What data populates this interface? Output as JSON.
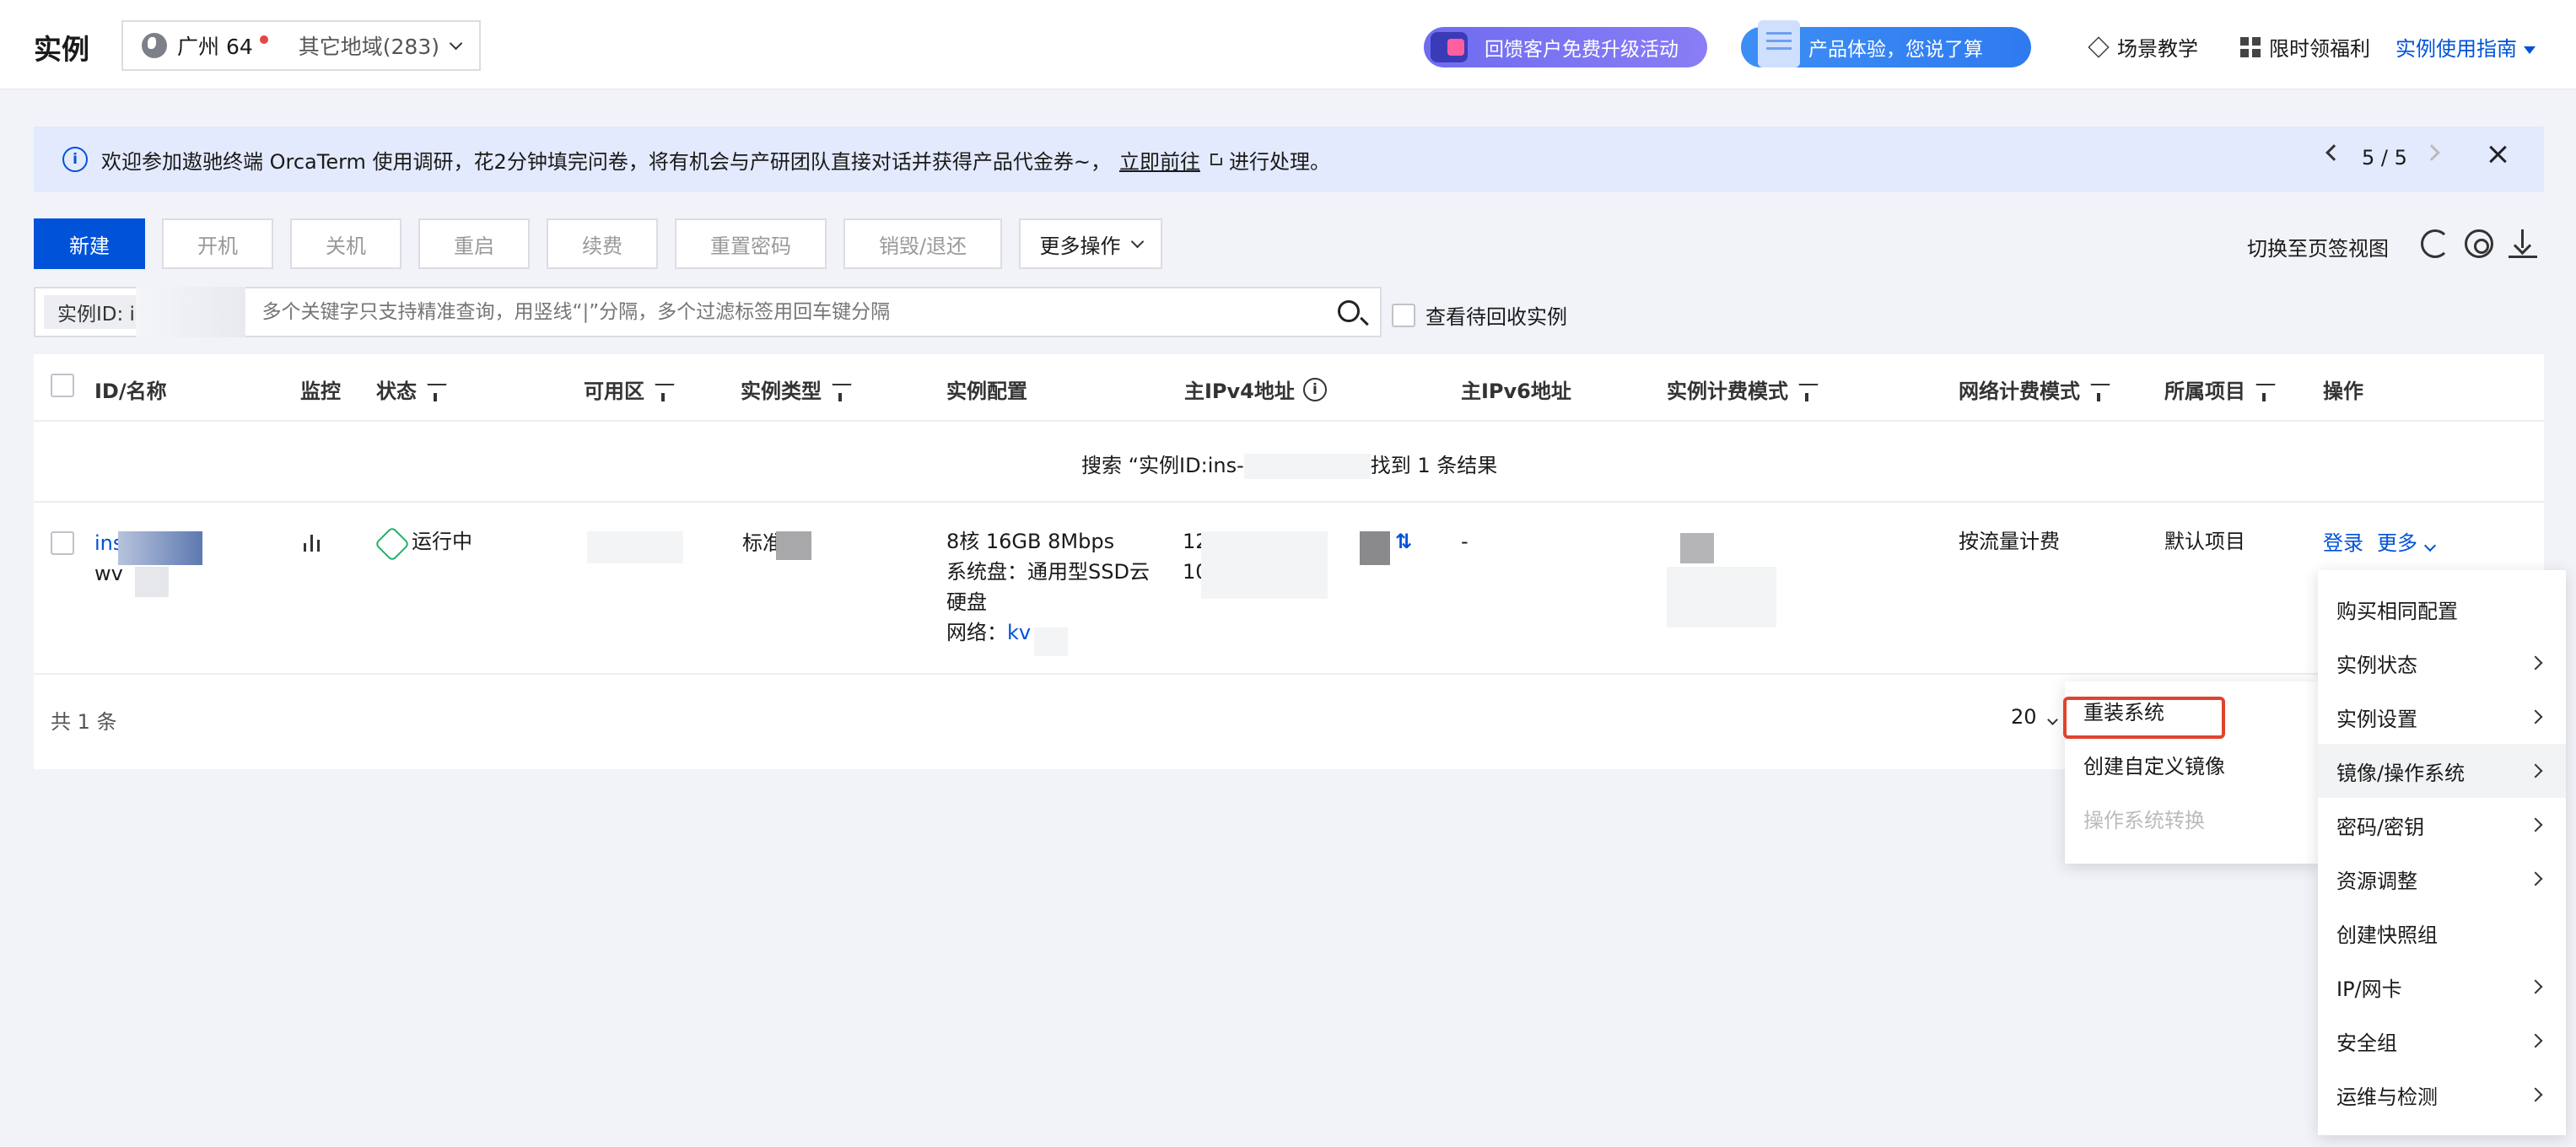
{
  "header": {
    "title": "实例",
    "current_region": "广州 64",
    "other_regions": "其它地域(283)",
    "promo1": "回馈客户免费升级活动",
    "promo2": "产品体验，您说了算",
    "link_tutorial": "场景教学",
    "link_welfare": "限时领福利",
    "link_guide": "实例使用指南"
  },
  "notice": {
    "info_glyph": "i",
    "text": "欢迎参加遨驰终端 OrcaTerm 使用调研，花2分钟填完问卷，将有机会与产研团队直接对话并获得产品代金券~，",
    "link": "立即前往",
    "suffix": "进行处理。",
    "pager": "5 / 5"
  },
  "toolbar": {
    "new": "新建",
    "start": "开机",
    "stop": "关机",
    "restart": "重启",
    "renew": "续费",
    "reset_password": "重置密码",
    "destroy": "销毁/退还",
    "more": "更多操作",
    "switch_view": "切换至页签视图"
  },
  "search": {
    "tag": "实例ID: in",
    "placeholder": "多个关键字只支持精准查询，用竖线“|”分隔，多个过滤标签用回车键分隔",
    "recycle_label": "查看待回收实例"
  },
  "table": {
    "headers": [
      "ID/名称",
      "监控",
      "状态",
      "可用区",
      "实例类型",
      "实例配置",
      "主IPv4地址",
      "主IPv6地址",
      "实例计费模式",
      "网络计费模式",
      "所属项目",
      "操作"
    ],
    "help_glyph": "i",
    "search_result_prefix": "搜索 “实例ID:ins-",
    "search_result_suffix": "找到 1 条结果",
    "row": {
      "id_prefix": "ins",
      "name_prefix": "wv",
      "status": "运行中",
      "type_prefix": "标准",
      "config_line1": "8核 16GB 8Mbps",
      "config_line2": "系统盘：通用型SSD云",
      "config_line3": "硬盘",
      "config_net_label": "网络：",
      "config_net_value": "kv",
      "ipv4_1": "12",
      "ipv4_2": "10",
      "ipv6": "-",
      "net_billing": "按流量计费",
      "project": "默认项目",
      "op_login": "登录",
      "op_more": "更多"
    },
    "total": "共 1 条",
    "page_size": "20"
  },
  "more_menu": {
    "items": [
      {
        "label": "购买相同配置",
        "submenu": false
      },
      {
        "label": "实例状态",
        "submenu": true
      },
      {
        "label": "实例设置",
        "submenu": true
      },
      {
        "label": "镜像/操作系统",
        "submenu": true,
        "active": true
      },
      {
        "label": "密码/密钥",
        "submenu": true
      },
      {
        "label": "资源调整",
        "submenu": true
      },
      {
        "label": "创建快照组",
        "submenu": false
      },
      {
        "label": "IP/网卡",
        "submenu": true
      },
      {
        "label": "安全组",
        "submenu": true
      },
      {
        "label": "运维与检测",
        "submenu": true
      }
    ]
  },
  "image_submenu": {
    "items": [
      {
        "label": "重装系统",
        "highlighted": true
      },
      {
        "label": "创建自定义镜像"
      },
      {
        "label": "操作系统转换",
        "disabled": true
      }
    ]
  },
  "colors": {
    "primary": "#0052d9",
    "running": "#24b26b",
    "highlight_border": "#e0432e",
    "notice_bg": "#e3eafd"
  }
}
